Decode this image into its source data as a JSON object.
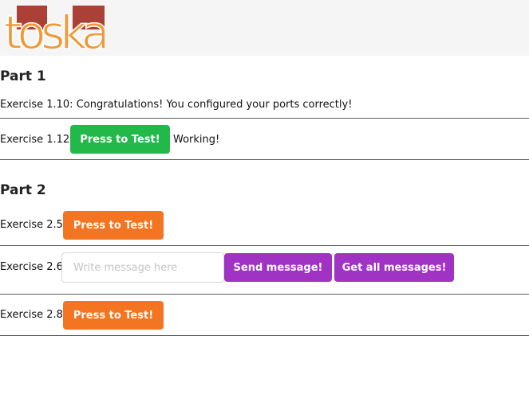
{
  "header": {
    "logo_text": "toska",
    "logo_colors": {
      "red": "#ab4036",
      "orange": "#ee9a3b"
    }
  },
  "part1": {
    "title": "Part 1",
    "ex_1_10": {
      "label": "Exercise 1.10:",
      "message": "Congratulations! You configured your ports correctly!"
    },
    "ex_1_12": {
      "label": "Exercise 1.12:",
      "button": "Press to Test!",
      "status": "Working!"
    }
  },
  "part2": {
    "title": "Part 2",
    "ex_2_5": {
      "label": "Exercise 2.5:",
      "button": "Press to Test!"
    },
    "ex_2_6": {
      "label": "Exercise 2.6:",
      "input_placeholder": "Write message here",
      "input_value": "",
      "send_button": "Send message!",
      "get_button": "Get all messages!"
    },
    "ex_2_8": {
      "label": "Exercise 2.8:",
      "button": "Press to Test!"
    }
  },
  "colors": {
    "green_button": "#22b84a",
    "orange_button": "#f47521",
    "purple_button": "#a033c4",
    "divider": "#5a5a5a",
    "header_bg": "#f5f5f5"
  }
}
